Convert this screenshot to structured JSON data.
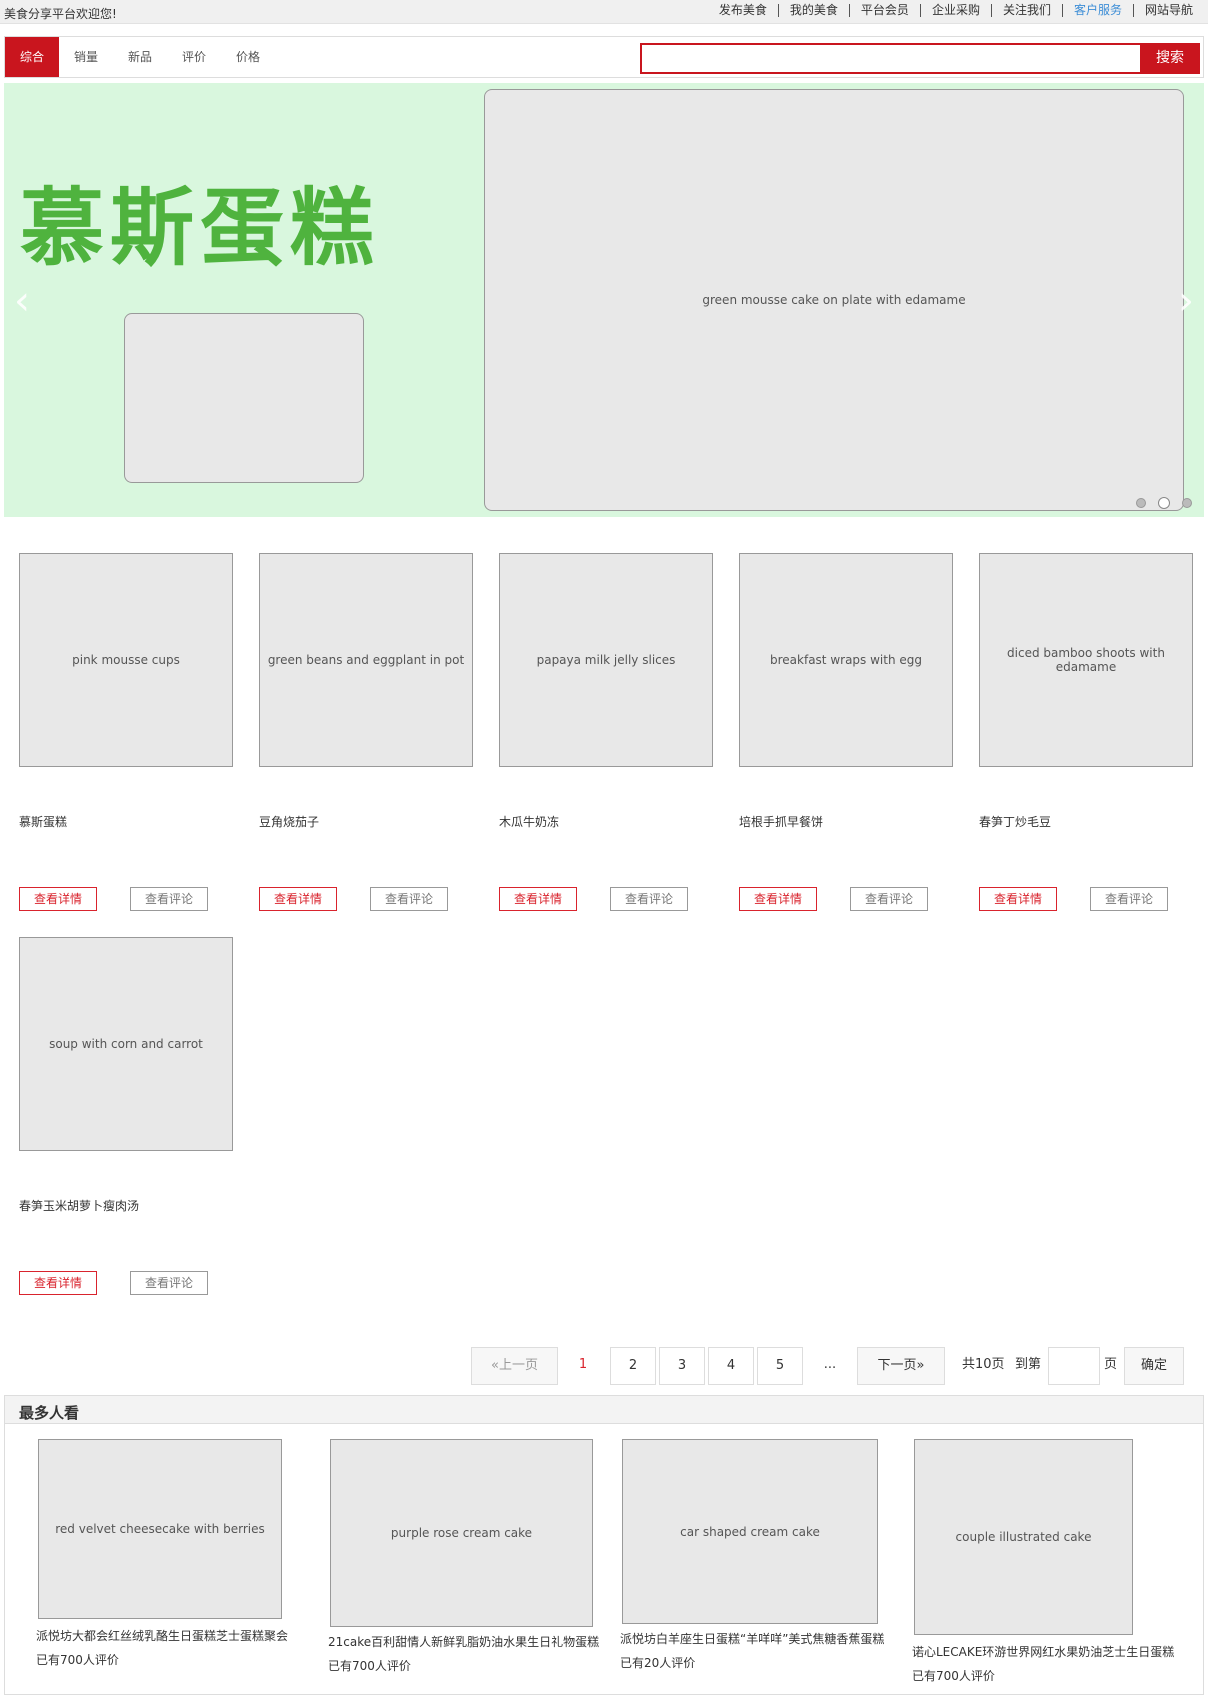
{
  "topbar": {
    "welcome": "美食分享平台欢迎您!",
    "nav": [
      "发布美食",
      "我的美食",
      "平台会员",
      "企业采购",
      "关注我们",
      "客户服务",
      "网站导航"
    ]
  },
  "sort_tabs": [
    "综合",
    "销量",
    "新品",
    "评价",
    "价格"
  ],
  "search": {
    "placeholder": "",
    "button": "搜索"
  },
  "banner": {
    "title": "慕斯蛋糕",
    "image_alt": "green mousse cake on plate with edamame"
  },
  "products": [
    {
      "title": "慕斯蛋糕",
      "image_alt": "pink mousse cups",
      "detail": "查看详情",
      "review": "查看评论"
    },
    {
      "title": "豆角烧茄子",
      "image_alt": "green beans and eggplant in pot",
      "detail": "查看详情",
      "review": "查看评论"
    },
    {
      "title": "木瓜牛奶冻",
      "image_alt": "papaya milk jelly slices",
      "detail": "查看详情",
      "review": "查看评论"
    },
    {
      "title": "培根手抓早餐饼",
      "image_alt": "breakfast wraps with egg",
      "detail": "查看详情",
      "review": "查看评论"
    },
    {
      "title": "春笋丁炒毛豆",
      "image_alt": "diced bamboo shoots with edamame",
      "detail": "查看详情",
      "review": "查看评论"
    },
    {
      "title": "春笋玉米胡萝卜瘦肉汤",
      "image_alt": "soup with corn and carrot",
      "detail": "查看详情",
      "review": "查看评论"
    }
  ],
  "pagination": {
    "prev": "«上一页",
    "pages": [
      "1",
      "2",
      "3",
      "4",
      "5"
    ],
    "ellipsis": "...",
    "next": "下一页»",
    "total": "共10页",
    "goto": "到第",
    "page_unit": "页",
    "confirm": "确定"
  },
  "popular": {
    "title": "最多人看",
    "items": [
      {
        "name": "派悦坊大都会红丝绒乳酪生日蛋糕芝士蛋糕聚会",
        "count": "已有700人评价",
        "image_alt": "red velvet cheesecake with berries"
      },
      {
        "name": "21cake百利甜情人新鲜乳脂奶油水果生日礼物蛋糕",
        "count": "已有700人评价",
        "image_alt": "purple rose cream cake"
      },
      {
        "name": "派悦坊白羊座生日蛋糕“羊咩咩”美式焦糖香蕉蛋糕",
        "count": "已有20人评价",
        "image_alt": "car shaped cream cake"
      },
      {
        "name": "诺心LECAKE环游世界网红水果奶油芝士生日蛋糕",
        "count": "已有700人评价",
        "image_alt": "couple illustrated cake"
      }
    ]
  },
  "colors": {
    "accent": "#c9151e",
    "link": "#3c8dd6"
  }
}
